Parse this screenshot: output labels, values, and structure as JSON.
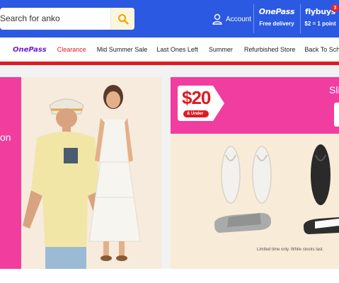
{
  "header": {
    "search": {
      "text": "Search for anko"
    },
    "account_label": "Account",
    "onepass": {
      "brand": "OnePass",
      "sub": "Free delivery"
    },
    "flybuys": {
      "brand": "flybuys",
      "sub": "$2 = 1 point",
      "badge": "3"
    }
  },
  "nav": {
    "onepass_label": "OnePass",
    "items": [
      "Clearance",
      "Mid Summer Sale",
      "Last Ones Left",
      "Summer",
      "Refurbished Store",
      "Back To School"
    ]
  },
  "banners": {
    "left_partial_text": "on",
    "right": {
      "price": "$20",
      "price_sub": "& Under",
      "partial_heading": "Sli",
      "disclaimer": "Limited time only. While stocks last."
    }
  },
  "colors": {
    "header_blue": "#2b59e1",
    "promo_pink": "#f03d9e",
    "nav_red": "#e01a22",
    "onepass_purple": "#6b1ed6",
    "clearance_red": "#e01a22"
  }
}
